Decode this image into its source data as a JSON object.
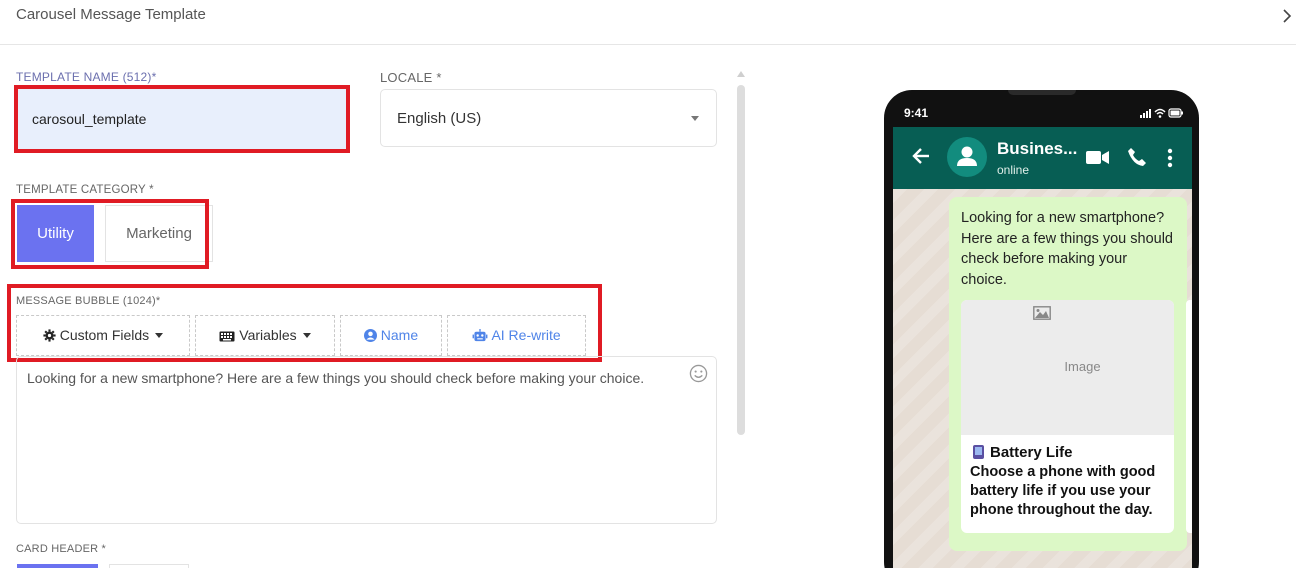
{
  "header": {
    "title": "Carousel Message Template"
  },
  "form": {
    "template_name_label": "TEMPLATE NAME (512)*",
    "template_name_value": "carosoul_template",
    "locale_label": "LOCALE *",
    "locale_value": "English (US)",
    "category_label": "TEMPLATE CATEGORY *",
    "category_options": [
      "Utility",
      "Marketing"
    ],
    "category_selected": "Utility",
    "message_label": "MESSAGE BUBBLE (1024)*",
    "toolbar": {
      "custom_fields": "Custom Fields",
      "variables": "Variables",
      "name": "Name",
      "ai_rewrite": "AI Re-write"
    },
    "message_text": "Looking for a new smartphone? Here are a few things you should check before making your choice.",
    "card_header_label": "CARD HEADER *"
  },
  "preview": {
    "status_time": "9:41",
    "contact_name": "Busines...",
    "contact_status": "online",
    "bubble_text": "Looking for a new smartphone? Here are a few things you should check before making your choice.",
    "card": {
      "image_placeholder": "Image",
      "title": "Battery Life",
      "body": "Choose a phone with good battery life if you use your phone throughout the day."
    }
  },
  "colors": {
    "accent": "#6b72f0",
    "highlight_red": "#e01b24",
    "whatsapp_header": "#075e54",
    "bubble_green": "#dcf8c6",
    "link_blue": "#4f84e8"
  }
}
